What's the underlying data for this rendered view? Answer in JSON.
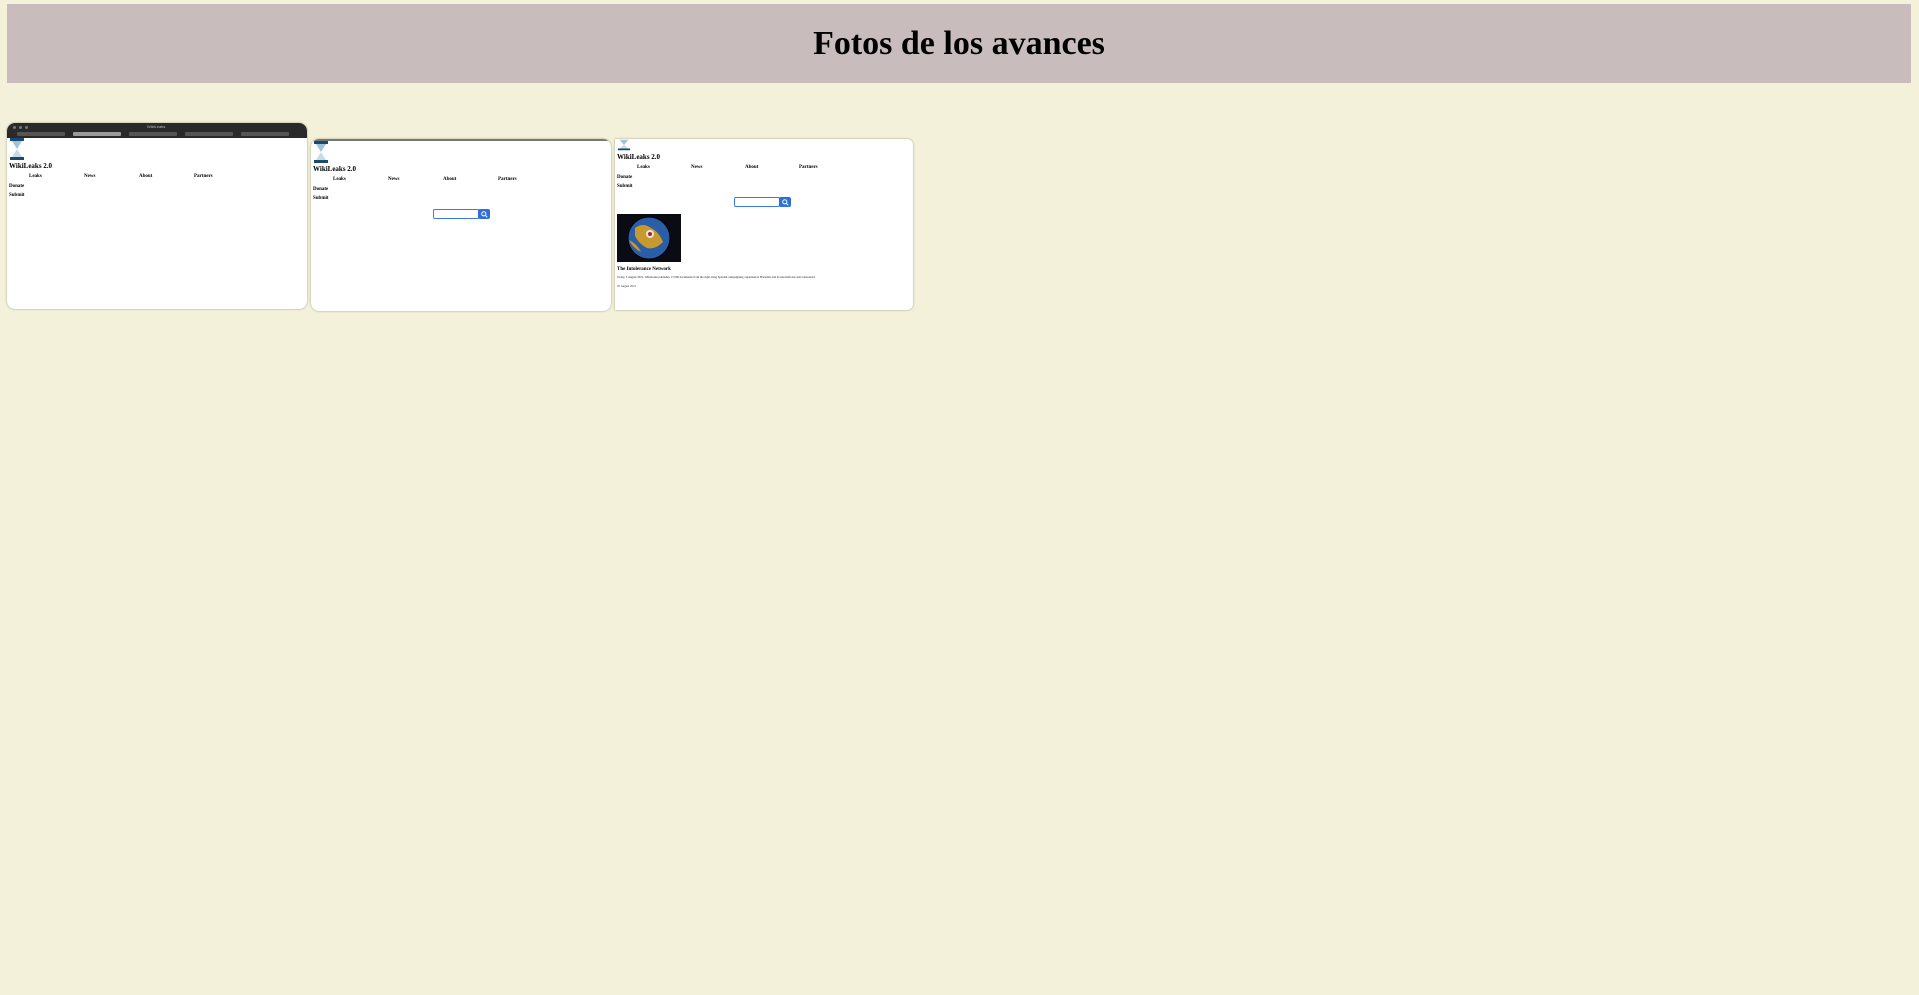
{
  "page": {
    "title": "Fotos de los avances"
  },
  "screenshots": [
    {
      "window_title": "WikiLeaks",
      "site_title": "WikiLeaks 2.0",
      "nav": [
        "Leaks",
        "News",
        "About",
        "Partners"
      ],
      "side_links": [
        "Donate",
        "Submit"
      ]
    },
    {
      "site_title": "WikiLeaks 2.0",
      "nav": [
        "Leaks",
        "News",
        "About",
        "Partners"
      ],
      "side_links": [
        "Donate",
        "Submit"
      ]
    },
    {
      "site_title": "WikiLeaks 2.0",
      "nav": [
        "Leaks",
        "News",
        "About",
        "Partners"
      ],
      "side_links": [
        "Donate",
        "Submit"
      ],
      "article": {
        "title": "The Intolerance Network",
        "text": "Today, 5 August 2021, WikiLeaks publishes 17,000 documents from the right-wing Spanish campaigning organization HazteOir and its international arm CitizenGO.",
        "date": "05 August 2021"
      }
    }
  ],
  "icons": {
    "logo": "hourglass-icon",
    "search": "search-icon"
  },
  "colors": {
    "background": "#f3f1d9",
    "header": "#c8bcbc",
    "search_button": "#2f6fd8"
  }
}
